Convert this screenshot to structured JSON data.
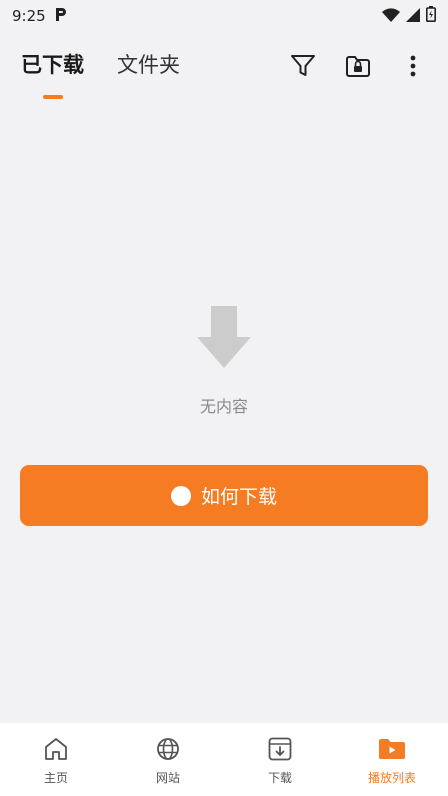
{
  "status_bar": {
    "time": "9:25"
  },
  "tabs": [
    {
      "label": "已下载",
      "active": true
    },
    {
      "label": "文件夹",
      "active": false
    }
  ],
  "toolbar_icons": [
    "filter-icon",
    "folder-lock-icon",
    "more-vert-icon"
  ],
  "empty_state": {
    "icon": "download-arrow-icon",
    "text": "无内容"
  },
  "how_button": {
    "label": "如何下载",
    "icon": "help-icon"
  },
  "bottom_nav": {
    "items": [
      {
        "label": "主页",
        "icon": "home-icon",
        "active": false
      },
      {
        "label": "网站",
        "icon": "globe-icon",
        "active": false
      },
      {
        "label": "下载",
        "icon": "download-icon",
        "active": false
      },
      {
        "label": "播放列表",
        "icon": "playlist-icon",
        "active": true
      }
    ]
  },
  "colors": {
    "accent": "#f57c22",
    "background": "#f2f2f4",
    "muted": "#cccccc"
  }
}
